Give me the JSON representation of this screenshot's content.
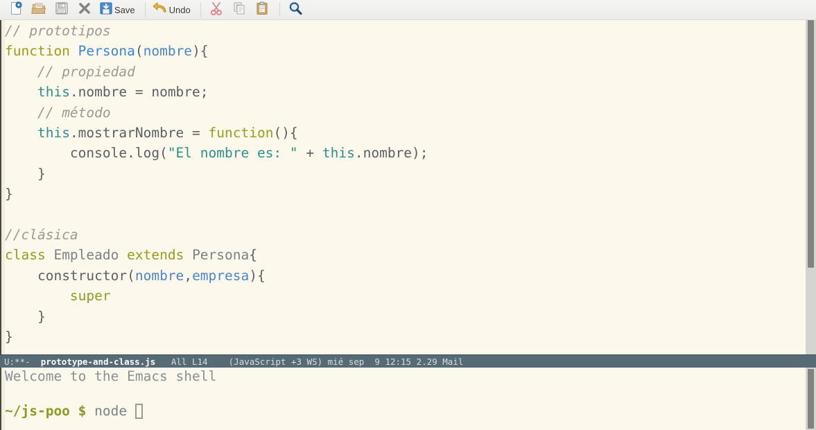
{
  "toolbar": {
    "items": [
      {
        "name": "new-file-icon",
        "label": ""
      },
      {
        "name": "open-file-icon",
        "label": ""
      },
      {
        "name": "save-as-icon",
        "label": ""
      },
      {
        "name": "close-buffer-icon",
        "label": ""
      },
      {
        "name": "save-icon",
        "label": "Save"
      },
      {
        "name": "undo-icon",
        "label": "Undo"
      },
      {
        "name": "cut-icon",
        "label": ""
      },
      {
        "name": "copy-icon",
        "label": ""
      },
      {
        "name": "paste-icon",
        "label": ""
      },
      {
        "name": "search-icon",
        "label": ""
      }
    ],
    "save_label": "Save",
    "undo_label": "Undo"
  },
  "editor": {
    "language": "JavaScript",
    "code_lines": [
      {
        "indent": 0,
        "tokens": [
          {
            "t": "// prototipos",
            "c": "cmt"
          }
        ]
      },
      {
        "indent": 0,
        "tokens": [
          {
            "t": "function",
            "c": "kw"
          },
          {
            "t": " ",
            "c": "plain"
          },
          {
            "t": "Persona",
            "c": "fn"
          },
          {
            "t": "(",
            "c": "plain"
          },
          {
            "t": "nombre",
            "c": "var"
          },
          {
            "t": "){",
            "c": "plain"
          }
        ]
      },
      {
        "indent": 1,
        "tokens": [
          {
            "t": "// propiedad",
            "c": "cmt"
          }
        ]
      },
      {
        "indent": 1,
        "tokens": [
          {
            "t": "this",
            "c": "this"
          },
          {
            "t": ".nombre = nombre;",
            "c": "plain"
          }
        ]
      },
      {
        "indent": 1,
        "tokens": [
          {
            "t": "// método",
            "c": "cmt"
          }
        ]
      },
      {
        "indent": 1,
        "tokens": [
          {
            "t": "this",
            "c": "this"
          },
          {
            "t": ".mostrarNombre = ",
            "c": "plain"
          },
          {
            "t": "function",
            "c": "kw"
          },
          {
            "t": "(){",
            "c": "plain"
          }
        ]
      },
      {
        "indent": 2,
        "tokens": [
          {
            "t": "console.log(",
            "c": "plain"
          },
          {
            "t": "\"El nombre es: \"",
            "c": "str"
          },
          {
            "t": " + ",
            "c": "plain"
          },
          {
            "t": "this",
            "c": "this"
          },
          {
            "t": ".nombre);",
            "c": "plain"
          }
        ]
      },
      {
        "indent": 1,
        "tokens": [
          {
            "t": "}",
            "c": "plain"
          }
        ]
      },
      {
        "indent": 0,
        "tokens": [
          {
            "t": "}",
            "c": "plain"
          }
        ]
      },
      {
        "indent": 0,
        "tokens": []
      },
      {
        "indent": 0,
        "tokens": [
          {
            "t": "//clásica",
            "c": "cmt"
          }
        ]
      },
      {
        "indent": 0,
        "tokens": [
          {
            "t": "class",
            "c": "kw"
          },
          {
            "t": " ",
            "c": "plain"
          },
          {
            "t": "Empleado",
            "c": "type"
          },
          {
            "t": " ",
            "c": "plain"
          },
          {
            "t": "extends",
            "c": "kw"
          },
          {
            "t": " ",
            "c": "plain"
          },
          {
            "t": "Persona",
            "c": "type"
          },
          {
            "t": "{",
            "c": "plain"
          }
        ]
      },
      {
        "indent": 1,
        "tokens": [
          {
            "t": "constructor(",
            "c": "plain"
          },
          {
            "t": "nombre",
            "c": "var"
          },
          {
            "t": ",",
            "c": "plain"
          },
          {
            "t": "empresa",
            "c": "var"
          },
          {
            "t": "){",
            "c": "plain"
          }
        ]
      },
      {
        "indent": 2,
        "tokens": [
          {
            "t": "super",
            "c": "sup"
          }
        ]
      },
      {
        "indent": 1,
        "tokens": [
          {
            "t": "}",
            "c": "plain"
          }
        ]
      },
      {
        "indent": 0,
        "tokens": [
          {
            "t": "}",
            "c": "plain"
          }
        ]
      }
    ],
    "code_text": "// prototipos\nfunction Persona(nombre){\n    // propiedad\n    this.nombre = nombre;\n    // método\n    this.mostrarNombre = function(){\n        console.log(\"El nombre es: \" + this.nombre);\n    }\n}\n\n//clásica\nclass Empleado extends Persona{\n    constructor(nombre,empresa){\n        super\n    }\n}"
  },
  "mode_line": {
    "status": "U:**-",
    "file_name": "prototype-and-class.js",
    "position_all": "All",
    "line": "L14",
    "minor_modes": "(JavaScript +3 WS)",
    "date": "mié sep  9",
    "time": "12:15",
    "load": "2.29",
    "mail": "Mail",
    "full": "U:**-  prototype-and-class.js   All L14    (JavaScript +3 WS) mié sep  9 12:15 2.29 Mail"
  },
  "shell": {
    "welcome": "Welcome to the Emacs shell",
    "prompt": "~/js-poo $",
    "command": "node"
  },
  "colors": {
    "background": "#fdf8ec",
    "mode_line_bg": "#566b75",
    "keyword": "#9a9c1a",
    "function_name": "#3b86d8",
    "string": "#2e9189",
    "comment": "#9a9a96",
    "toolbar_bg": "#f0f0ee"
  },
  "scrollbars": {
    "code": {
      "thumb_top_pct": 0,
      "thumb_height_pct": 74
    },
    "shell": {
      "thumb_top_pct": 2,
      "thumb_height_pct": 96
    }
  }
}
